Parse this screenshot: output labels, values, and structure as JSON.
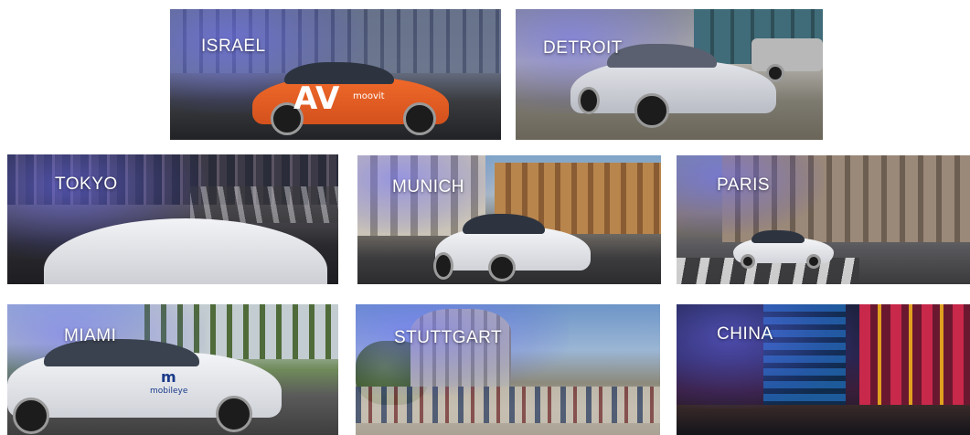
{
  "tiles": [
    {
      "id": "israel",
      "label": "ISRAEL"
    },
    {
      "id": "detroit",
      "label": "DETROIT"
    },
    {
      "id": "tokyo",
      "label": "TOKYO"
    },
    {
      "id": "munich",
      "label": "MUNICH"
    },
    {
      "id": "paris",
      "label": "PARIS"
    },
    {
      "id": "miami",
      "label": "MIAMI"
    },
    {
      "id": "stuttgart",
      "label": "STUTTGART"
    },
    {
      "id": "china",
      "label": "CHINA"
    }
  ],
  "car_logos": {
    "israel_brand": "moovit",
    "israel_mark": "AV",
    "miami_brand": "mobileye",
    "miami_mark": "m"
  }
}
